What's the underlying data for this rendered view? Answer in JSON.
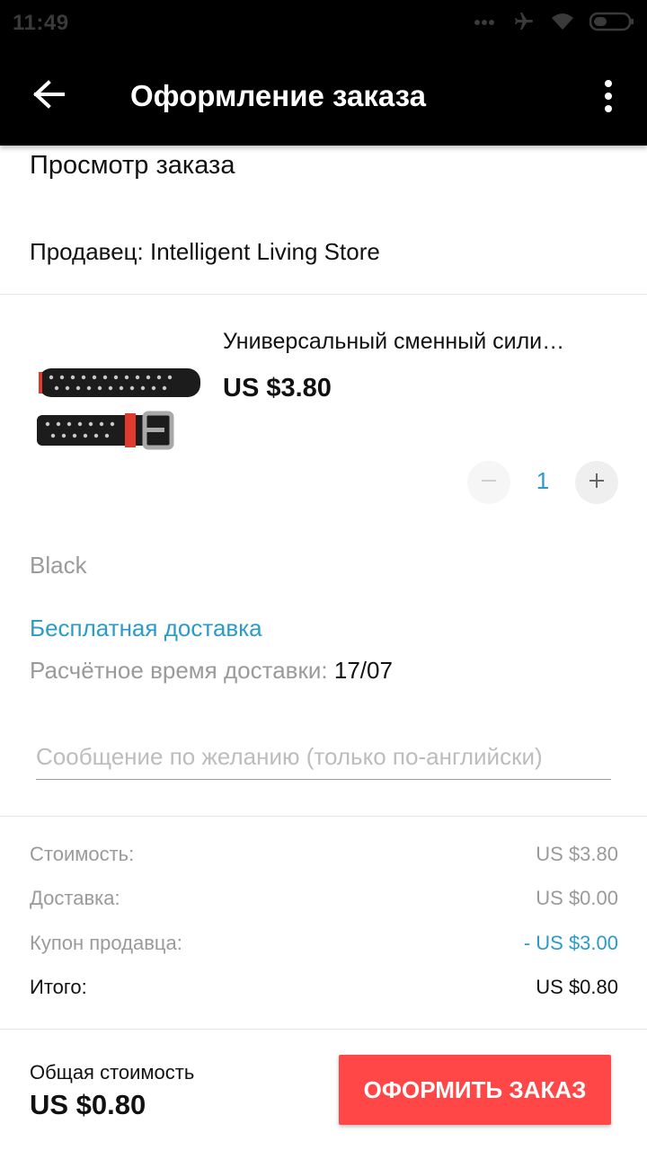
{
  "status_bar": {
    "time": "11:49",
    "icons": [
      "signal-dots-icon",
      "airplane-icon",
      "wifi-icon",
      "battery-icon"
    ]
  },
  "app_bar": {
    "title": "Оформление заказа",
    "back_icon": "arrow-back-icon",
    "menu_icon": "more-vert-icon"
  },
  "order": {
    "section_title": "Просмотр заказа",
    "seller": "Продавец: Intelligent Living Store"
  },
  "product": {
    "name": "Универсальный сменный сили…",
    "price": "US $3.80",
    "quantity": "1",
    "variant": "Black"
  },
  "shipping": {
    "free_shipping": "Бесплатная доставка",
    "eta_label": "Расчётное время доставки:",
    "eta_date": "17/07"
  },
  "message": {
    "placeholder": "Сообщение по желанию (только по-английски)"
  },
  "summary": {
    "cost_label": "Стоимость:",
    "cost_value": "US $3.80",
    "shipping_label": "Доставка:",
    "shipping_value": "US $0.00",
    "coupon_label": "Купон продавца:",
    "coupon_value": "- US $3.00",
    "total_label": "Итого:",
    "total_value": "US $0.80"
  },
  "footer": {
    "total_label": "Общая стоимость",
    "total_value": "US $0.80",
    "checkout_label": "ОФОРМИТЬ ЗАКАЗ"
  },
  "colors": {
    "accent_blue": "#2b9bc9",
    "checkout_red": "#ff4747",
    "app_bar": "#000000"
  }
}
